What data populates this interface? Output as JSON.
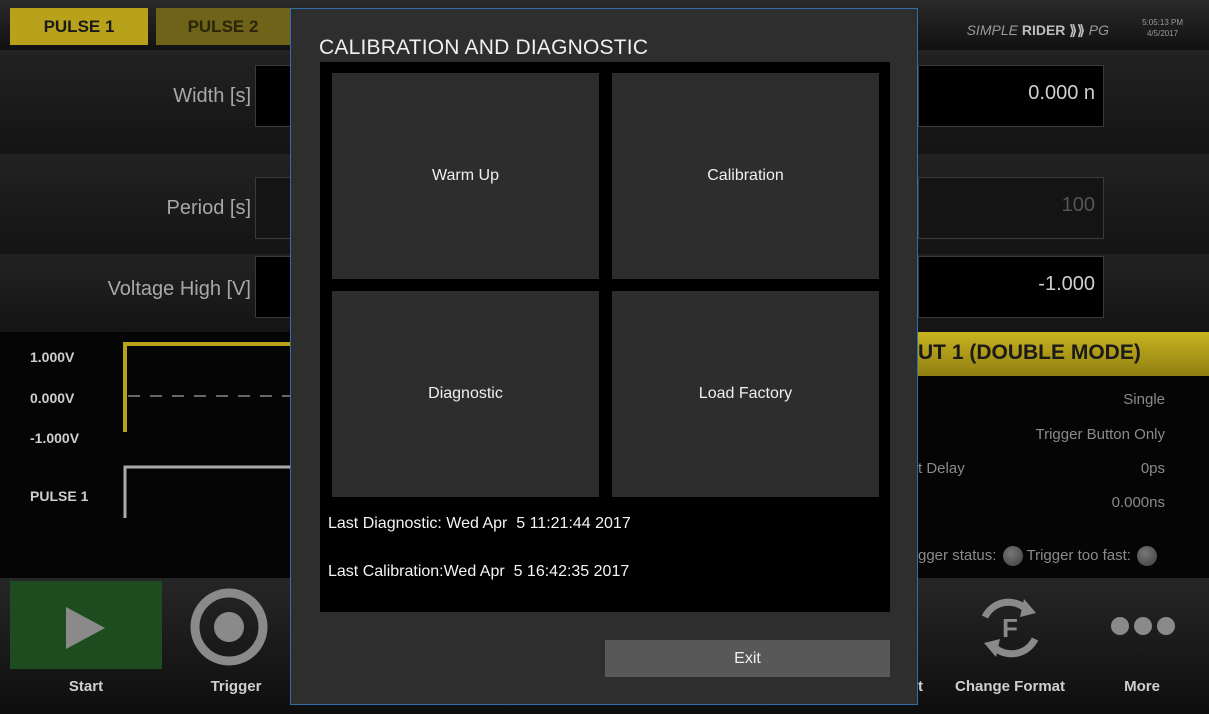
{
  "app": {
    "tabs": [
      {
        "label": "PULSE 1"
      },
      {
        "label": "PULSE 2"
      }
    ],
    "brand": {
      "prefix": "SIMPLE",
      "name": "RIDER",
      "suffix": "PG"
    },
    "clock": {
      "time": "5:05:13 PM",
      "date": "4/5/2017"
    }
  },
  "params": [
    {
      "label": "Width [s]",
      "right_value": "0.000 n"
    },
    {
      "label": "Period [s]",
      "right_value": "100"
    },
    {
      "label": "Voltage High [V]",
      "right_value": "-1.000"
    }
  ],
  "waveform": {
    "levels": [
      "1.000V",
      "0.000V",
      "-1.000V"
    ],
    "channel": "PULSE 1"
  },
  "output": {
    "header": "UT 1 (DOUBLE MODE)",
    "rows": [
      {
        "label": "",
        "value": "Single"
      },
      {
        "label": "",
        "value": "Trigger Button Only"
      },
      {
        "label": "Delay",
        "value": "0ps"
      },
      {
        "label": "",
        "value": "0.000ns"
      }
    ],
    "trigger_status": "gger status:",
    "trigger_too_fast": "Trigger too fast:"
  },
  "bottombar": {
    "start": "Start",
    "trigger": "Trigger",
    "partial": "t",
    "change_format": "Change Format",
    "more": "More"
  },
  "dialog": {
    "title": "CALIBRATION AND DIAGNOSTIC",
    "tiles": [
      "Warm Up",
      "Calibration",
      "Diagnostic",
      "Load Factory"
    ],
    "last_diagnostic": "Last Diagnostic: Wed Apr  5 11:21:44 2017",
    "last_calibration": "Last Calibration:Wed Apr  5 16:42:35 2017",
    "exit": "Exit"
  },
  "colors": {
    "accent": "#b8a11b",
    "dialog_border": "#2d6fa6",
    "start_green": "#1d4d1f"
  }
}
